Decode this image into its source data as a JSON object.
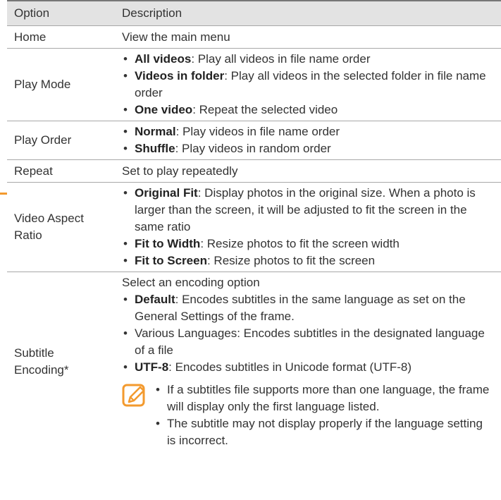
{
  "header": {
    "option": "Option",
    "description": "Description"
  },
  "rows": {
    "home": {
      "option": "Home",
      "desc": "View the main menu"
    },
    "play_mode": {
      "option": "Play Mode",
      "items": [
        {
          "term": "All videos",
          "text": ": Play all videos in file name order"
        },
        {
          "term": "Videos in folder",
          "text": ": Play all videos in the selected folder in file name order"
        },
        {
          "term": "One video",
          "text": ": Repeat the selected video"
        }
      ]
    },
    "play_order": {
      "option": "Play Order",
      "items": [
        {
          "term": "Normal",
          "text": ": Play videos in file name order"
        },
        {
          "term": "Shuffle",
          "text": ": Play videos in random order"
        }
      ]
    },
    "repeat": {
      "option": "Repeat",
      "desc": "Set to play repeatedly"
    },
    "aspect": {
      "option": "Video Aspect Ratio",
      "items": [
        {
          "term": "Original Fit",
          "text": ": Display photos in the original size. When a photo is larger than the screen, it will be adjusted to fit the screen in the same ratio"
        },
        {
          "term": "Fit to Width",
          "text": ": Resize photos to fit the screen width"
        },
        {
          "term": "Fit to Screen",
          "text": ": Resize photos to fit the screen"
        }
      ]
    },
    "encoding": {
      "option": "Subtitle Encoding*",
      "intro": "Select an encoding option",
      "items": [
        {
          "term": "Default",
          "text": ": Encodes subtitles in the same language as set on the General Settings of the frame."
        },
        {
          "term": "",
          "text": "Various Languages: Encodes subtitles in the designated language of a file"
        },
        {
          "term": "UTF-8",
          "text": ": Encodes subtitles in Unicode format (UTF-8)"
        }
      ],
      "notes": [
        "If a subtitles file supports more than one language, the frame will display only the first language listed.",
        "The subtitle may not display properly if the language setting is incorrect."
      ]
    }
  },
  "colors": {
    "accent": "#f39a2e",
    "header_bg": "#e3e3e3",
    "rule": "#a8a8a8"
  },
  "icons": {
    "note": "pencil-note-icon"
  }
}
